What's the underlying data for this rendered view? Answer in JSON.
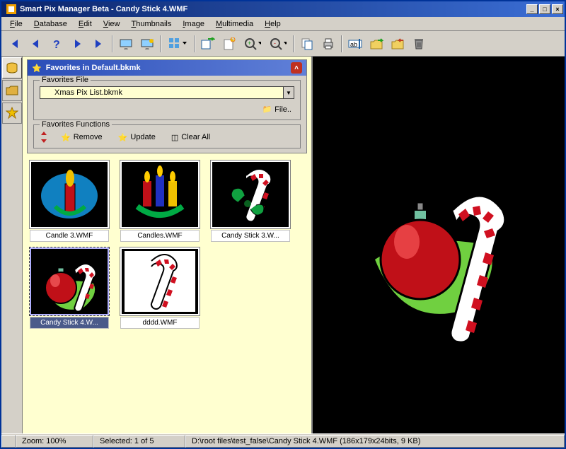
{
  "title": "Smart Pix Manager Beta - Candy Stick 4.WMF",
  "menu": [
    "File",
    "Database",
    "Edit",
    "View",
    "Thumbnails",
    "Image",
    "Multimedia",
    "Help"
  ],
  "favorites": {
    "panel_title": "Favorites in Default.bkmk",
    "file_group_label": "Favorites File",
    "file_value": "Xmas Pix List.bkmk",
    "file_button": "File..",
    "functions_label": "Favorites Functions",
    "remove": "Remove",
    "update": "Update",
    "clear": "Clear All"
  },
  "thumbnails": [
    {
      "caption": "Candle 3.WMF",
      "kind": "candle"
    },
    {
      "caption": "Candles.WMF",
      "kind": "candles"
    },
    {
      "caption": "Candy Stick 3.W...",
      "kind": "candy-bow"
    },
    {
      "caption": "Candy Stick 4.W...",
      "kind": "ornament-candy",
      "selected": true
    },
    {
      "caption": "dddd.WMF",
      "kind": "candy-plain"
    }
  ],
  "status": {
    "zoom": "Zoom: 100%",
    "selected": "Selected: 1 of 5",
    "path": "D:\\root files\\test_false\\Candy Stick 4.WMF  (186x179x24bits, 9 KB)"
  },
  "colors": {
    "accent": "#0a246a"
  }
}
